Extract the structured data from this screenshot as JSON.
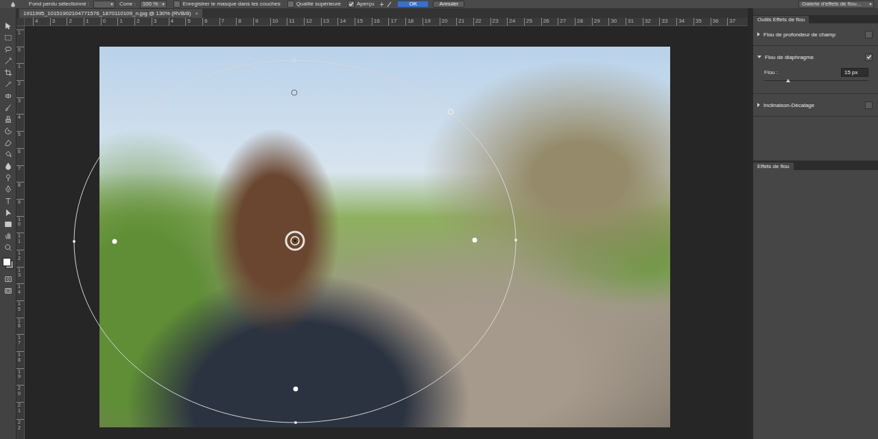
{
  "options_bar": {
    "bleed": {
      "label": "Fond perdu sélectionné :"
    },
    "cone": {
      "label": "Cone :",
      "value": "100 %"
    },
    "checkboxes": [
      {
        "label": "Enregistrer le masque dans les couches",
        "checked": false
      },
      {
        "label": "Qualité supérieure",
        "checked": false
      },
      {
        "label": "Aperçu",
        "checked": true
      }
    ],
    "buttons": [
      {
        "label": "OK",
        "primary": true
      },
      {
        "label": "Annuler",
        "primary": false
      }
    ],
    "workspace": "Galerie d'effets de flou..."
  },
  "document_tab": {
    "title": "1911995_10151902104771576_1870110109_n.jpg @ 130% (RVB/8)",
    "close": "×"
  },
  "rulers": {
    "top": [
      "4",
      "3",
      "2",
      "1",
      "0",
      "1",
      "2",
      "3",
      "4",
      "5",
      "6",
      "7",
      "8",
      "9",
      "10",
      "11",
      "12",
      "13",
      "14",
      "15",
      "16",
      "17",
      "18",
      "19",
      "20",
      "21",
      "22",
      "23",
      "24",
      "25",
      "26",
      "27",
      "28",
      "29",
      "30",
      "31",
      "32",
      "33",
      "34",
      "35",
      "36",
      "37"
    ],
    "left": [
      "1",
      "0",
      "1",
      "2",
      "3",
      "4",
      "5",
      "6",
      "7",
      "8",
      "9",
      "10",
      "11",
      "12",
      "13",
      "14",
      "15",
      "16",
      "17",
      "18",
      "19",
      "20",
      "21",
      "22"
    ]
  },
  "panel": {
    "title": "Outils Effets de flou",
    "sections": [
      {
        "label": "Flou de profondeur de champ",
        "expanded": false,
        "checked": false
      },
      {
        "label": "Flou de diaphragme",
        "expanded": true,
        "checked": true,
        "control": {
          "label": "Flou :",
          "value": "15 px",
          "level": 0.23
        }
      },
      {
        "label": "Inclinaison-Décalage",
        "expanded": false,
        "checked": false
      }
    ],
    "effects_title": "Effets de flou"
  }
}
